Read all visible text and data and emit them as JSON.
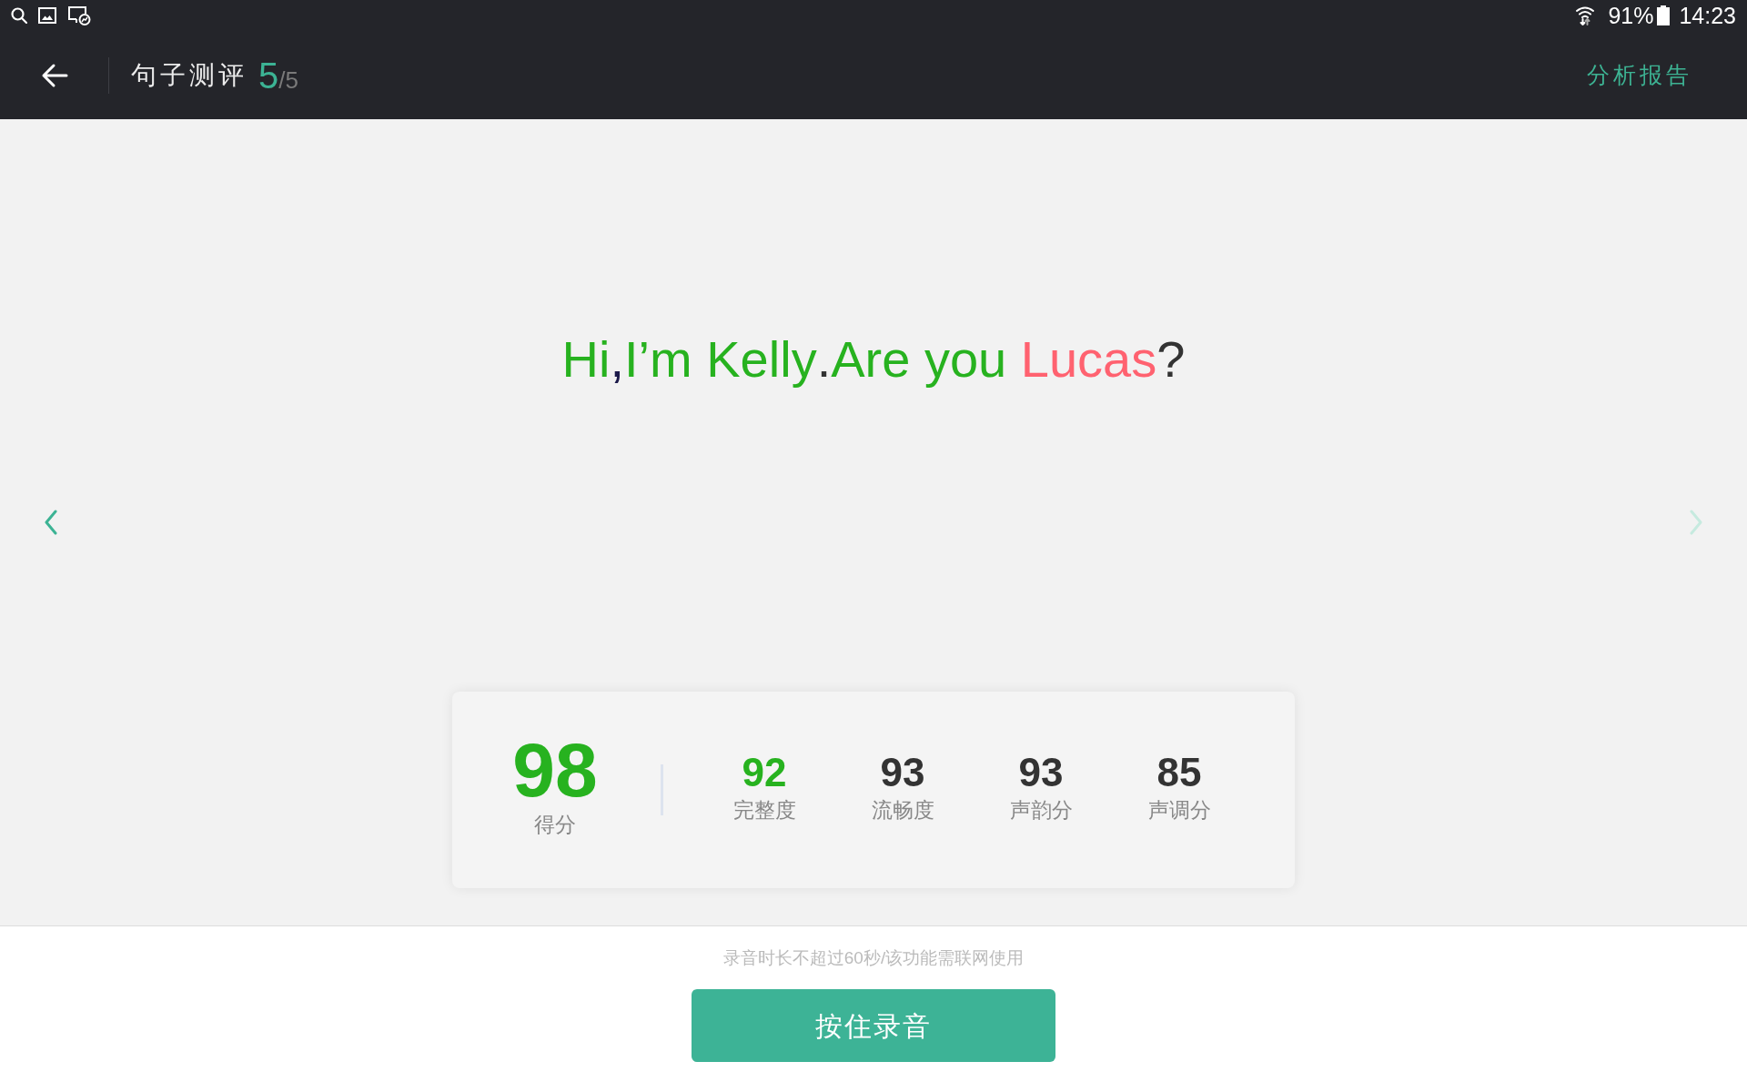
{
  "status_bar": {
    "battery": "91%",
    "time": "14:23"
  },
  "header": {
    "title": "句子测评",
    "progress_current": "5",
    "progress_total": "/5",
    "report_link": "分析报告"
  },
  "sentence": {
    "segments": [
      {
        "text": "Hi",
        "color": "#27b21f"
      },
      {
        "text": ",",
        "color": "#1c1a4a"
      },
      {
        "text": "I’m Kelly",
        "color": "#27b21f"
      },
      {
        "text": ".",
        "color": "#333333"
      },
      {
        "text": "Are you ",
        "color": "#27b21f"
      },
      {
        "text": "Lucas",
        "color": "#ff6270"
      },
      {
        "text": "?",
        "color": "#333333"
      }
    ]
  },
  "navigation": {
    "previous": {
      "disabled": false
    },
    "next": {
      "disabled": true
    }
  },
  "score_card": {
    "total": {
      "value": "98",
      "label": "得分"
    },
    "metrics": [
      {
        "value": "92",
        "label": "完整度",
        "color": "#27b21f"
      },
      {
        "value": "93",
        "label": "流畅度",
        "color": "#333333"
      },
      {
        "value": "93",
        "label": "声韵分",
        "color": "#333333"
      },
      {
        "value": "85",
        "label": "声调分",
        "color": "#333333"
      }
    ]
  },
  "footer": {
    "hint": "录音时长不超过60秒/该功能需联网使用",
    "record_button": "按住录音"
  }
}
